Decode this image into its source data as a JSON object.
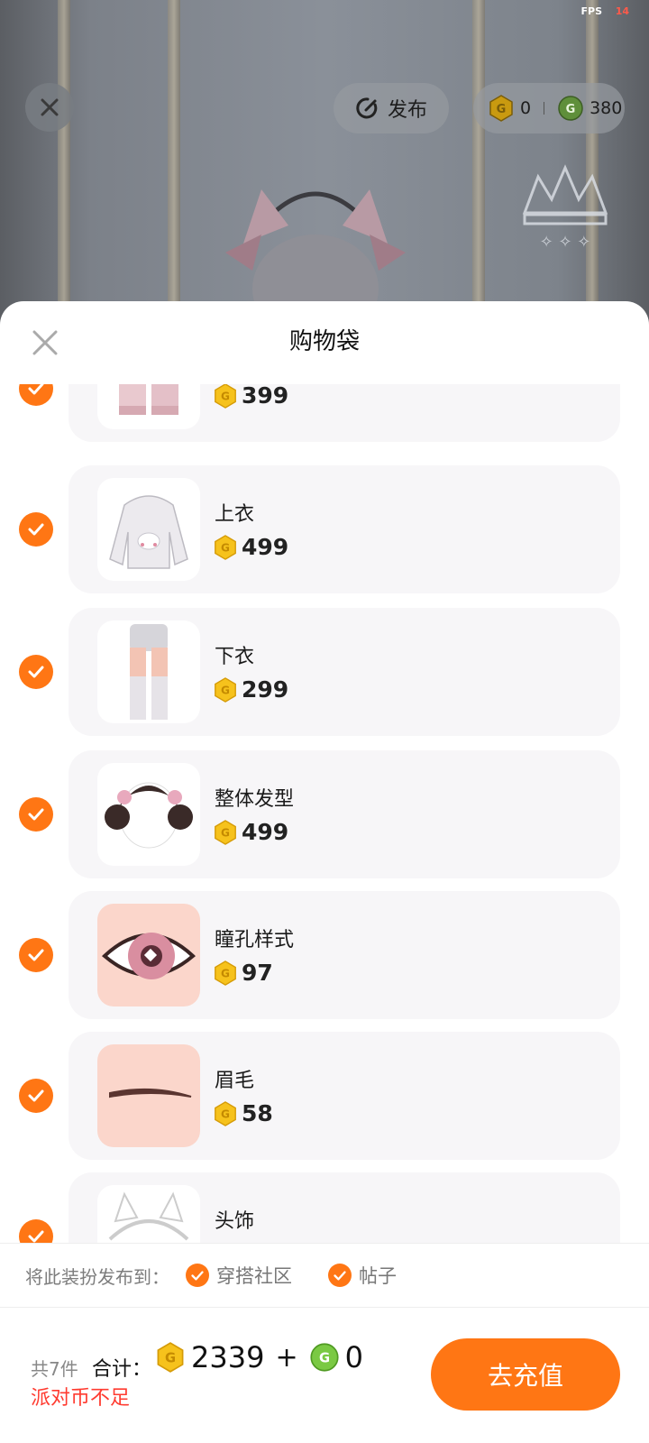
{
  "top_bar": {
    "fps_label": "FPS",
    "fps_value": "14",
    "publish_label": "发布",
    "currency_a": "0",
    "currency_b": "380"
  },
  "sheet": {
    "title": "购物袋",
    "items": [
      {
        "name": "",
        "price": "399",
        "thumb": "shoes-thumb"
      },
      {
        "name": "上衣",
        "price": "499",
        "thumb": "hoodie-thumb"
      },
      {
        "name": "下衣",
        "price": "299",
        "thumb": "leggings-thumb"
      },
      {
        "name": "整体发型",
        "price": "499",
        "thumb": "hairstyle-thumb"
      },
      {
        "name": "瞳孔样式",
        "price": "97",
        "thumb": "eye-thumb"
      },
      {
        "name": "眉毛",
        "price": "58",
        "thumb": "eyebrow-thumb"
      },
      {
        "name": "头饰",
        "price": "",
        "thumb": "headwear-thumb"
      }
    ]
  },
  "publish_options": {
    "label": "将此装扮发布到：",
    "option_1": "穿搭社区",
    "option_2": "帖子"
  },
  "footer": {
    "count": "共7件",
    "total_label": "合计：",
    "coin_total": "2339",
    "plus": "+",
    "green_total": "0",
    "warning": "派对币不足",
    "recharge_label": "去充值"
  },
  "colors": {
    "accent": "#ff7614",
    "warning": "#ff3b30",
    "gold_coin": "#f6c21c",
    "green_coin": "#7ac943"
  }
}
